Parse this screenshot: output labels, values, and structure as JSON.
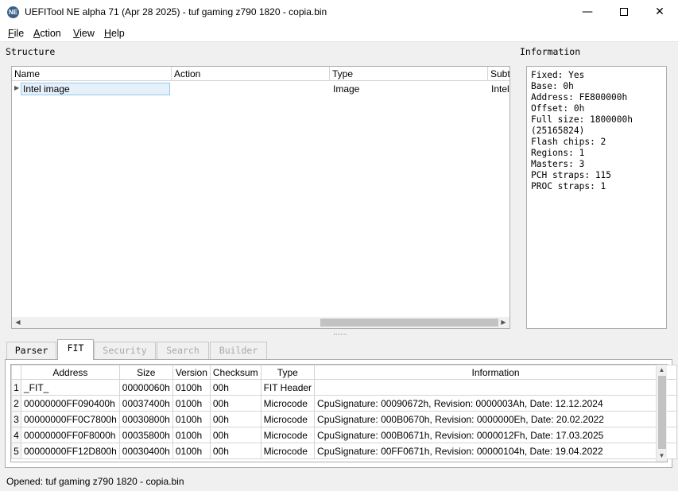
{
  "window": {
    "title": "UEFITool NE alpha 71 (Apr 28 2025) - tuf gaming z790 1820 - copia.bin",
    "icon_text": "NE"
  },
  "menu": [
    {
      "label": "File",
      "accel": "F",
      "rest": "ile"
    },
    {
      "label": "Action",
      "accel": "A",
      "rest": "ction"
    },
    {
      "label": "View",
      "accel": "V",
      "rest": "iew"
    },
    {
      "label": "Help",
      "accel": "H",
      "rest": "elp"
    }
  ],
  "structure": {
    "label": "Structure",
    "columns": [
      "Name",
      "Action",
      "Type",
      "Subt"
    ],
    "rows": [
      {
        "name": "Intel image",
        "action": "",
        "type": "Image",
        "subtype": "Intel"
      }
    ]
  },
  "information": {
    "label": "Information",
    "text": "Fixed: Yes\nBase: 0h\nAddress: FE800000h\nOffset: 0h\nFull size: 1800000h\n(25165824)\nFlash chips: 2\nRegions: 1\nMasters: 3\nPCH straps: 115\nPROC straps: 1"
  },
  "tabs": [
    {
      "label": "Parser",
      "state": "normal"
    },
    {
      "label": "FIT",
      "state": "active"
    },
    {
      "label": "Security",
      "state": "disabled"
    },
    {
      "label": "Search",
      "state": "disabled"
    },
    {
      "label": "Builder",
      "state": "disabled"
    }
  ],
  "fit_table": {
    "columns": [
      "Address",
      "Size",
      "Version",
      "Checksum",
      "Type",
      "Information"
    ],
    "rows": [
      {
        "n": "1",
        "address": "_FIT_",
        "size": "00000060h",
        "version": "0100h",
        "checksum": "00h",
        "type": "FIT Header",
        "info": ""
      },
      {
        "n": "2",
        "address": "00000000FF090400h",
        "size": "00037400h",
        "version": "0100h",
        "checksum": "00h",
        "type": "Microcode",
        "info": "CpuSignature: 00090672h, Revision: 0000003Ah, Date: 12.12.2024"
      },
      {
        "n": "3",
        "address": "00000000FF0C7800h",
        "size": "00030800h",
        "version": "0100h",
        "checksum": "00h",
        "type": "Microcode",
        "info": "CpuSignature: 000B0670h, Revision: 0000000Eh, Date: 20.02.2022"
      },
      {
        "n": "4",
        "address": "00000000FF0F8000h",
        "size": "00035800h",
        "version": "0100h",
        "checksum": "00h",
        "type": "Microcode",
        "info": "CpuSignature: 000B0671h, Revision: 0000012Fh, Date: 17.03.2025"
      },
      {
        "n": "5",
        "address": "00000000FF12D800h",
        "size": "00030400h",
        "version": "0100h",
        "checksum": "00h",
        "type": "Microcode",
        "info": "CpuSignature: 00FF0671h, Revision: 00000104h, Date: 19.04.2022"
      }
    ]
  },
  "status": {
    "text": "Opened: tuf gaming z790 1820 - copia.bin"
  }
}
